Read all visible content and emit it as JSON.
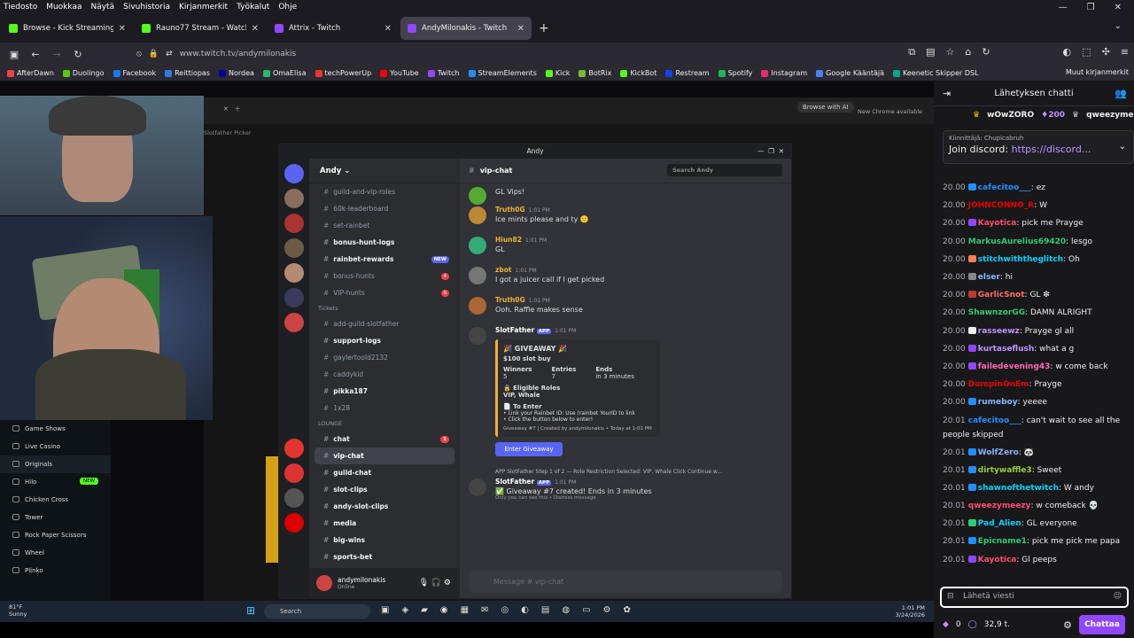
{
  "menu": [
    "Tiedosto",
    "Muokkaa",
    "Näytä",
    "Sivuhistoria",
    "Kirjanmerkit",
    "Työkalut",
    "Ohje"
  ],
  "window_controls": {
    "minimize": "—",
    "restore": "❐",
    "close": "✕"
  },
  "tabs": [
    {
      "label": "Browse - Kick Streaming",
      "color": "#53fc18"
    },
    {
      "label": "Rauno77 Stream - Watch L",
      "color": "#53fc18"
    },
    {
      "label": "Attrix - Twitch",
      "color": "#9146ff"
    },
    {
      "label": "AndyMilonakis - Twitch",
      "color": "#9146ff",
      "active": true
    }
  ],
  "tab_close": "✕",
  "url": "www.twitch.tv/andymilonakis",
  "bookmarks": [
    {
      "label": "AfterDawn",
      "color": "#e44"
    },
    {
      "label": "Duolingo",
      "color": "#58cc02"
    },
    {
      "label": "Facebook",
      "color": "#1877f2"
    },
    {
      "label": "Reittiopas",
      "color": "#2a7de1"
    },
    {
      "label": "Nordea",
      "color": "#0000a0"
    },
    {
      "label": "OmaElisa",
      "color": "#2b6"
    },
    {
      "label": "techPowerUp",
      "color": "#e33"
    },
    {
      "label": "YouTube",
      "color": "#f00"
    },
    {
      "label": "Twitch",
      "color": "#9146ff"
    },
    {
      "label": "StreamElements",
      "color": "#1e90ff"
    },
    {
      "label": "Kick",
      "color": "#53fc18"
    },
    {
      "label": "BotRix",
      "color": "#7b3"
    },
    {
      "label": "KickBot",
      "color": "#53fc18"
    },
    {
      "label": "Restream",
      "color": "#14f"
    },
    {
      "label": "Spotify",
      "color": "#1db954"
    },
    {
      "label": "Instagram",
      "color": "#e1306c"
    },
    {
      "label": "Google Kääntäjä",
      "color": "#4285f4"
    },
    {
      "label": "Keenetic Skipper DSL",
      "color": "#0a8"
    }
  ],
  "bookmarks_more": "Muut kirjanmerkit",
  "inner_browser": {
    "browse_ai": "Browse with AI",
    "chrome_available": "New Chrome available",
    "picker": "Slotfather Picker"
  },
  "kick_sidebar": [
    "Game Shows",
    "Live Casino",
    "Originals",
    "Hilo",
    "Chicken Cross",
    "Tower",
    "Rock Paper Scissors",
    "Wheel",
    "Plinko"
  ],
  "kick_new": "NEW",
  "discord": {
    "title": "Andy",
    "server": "Andy",
    "channel": "vip-chat",
    "search": "Search Andy",
    "channels": [
      {
        "name": "guild-and-vip-roles",
        "bold": false
      },
      {
        "name": "60k-leaderboard",
        "bold": false
      },
      {
        "name": "set-rainbet",
        "bold": false
      },
      {
        "name": "bonus-hunt-logs",
        "bold": true
      },
      {
        "name": "rainbet-rewards",
        "bold": true,
        "badge": "NEW"
      },
      {
        "name": "bonus-hunts",
        "bold": false,
        "badge": "4"
      },
      {
        "name": "VIP-hunts",
        "bold": false,
        "badge": "6"
      }
    ],
    "tickets_cat": "Tickets",
    "tickets": [
      {
        "name": "add-guild-slotfather",
        "bold": false
      },
      {
        "name": "support-logs",
        "bold": true
      },
      {
        "name": "gaylertoold2132",
        "bold": false
      },
      {
        "name": "caddykid",
        "bold": false
      },
      {
        "name": "pikka187",
        "bold": true
      },
      {
        "name": "1x28",
        "bold": false
      }
    ],
    "lounge_cat": "LOUNGE",
    "lounge": [
      {
        "name": "chat",
        "bold": true,
        "badge": "1"
      },
      {
        "name": "vip-chat",
        "bold": true,
        "selected": true
      },
      {
        "name": "guild-chat",
        "bold": true
      },
      {
        "name": "slot-clips",
        "bold": true
      },
      {
        "name": "andy-slot-clips",
        "bold": true
      },
      {
        "name": "media",
        "bold": true
      },
      {
        "name": "big-wins",
        "bold": true
      },
      {
        "name": "sports-bet",
        "bold": true
      }
    ],
    "user": {
      "name": "andymilonakis",
      "status": "Online"
    },
    "messages": [
      {
        "name": "",
        "time": "",
        "text": "GL Vips!",
        "color": "#dbdee1"
      },
      {
        "name": "Truth0G",
        "time": "1:01 PM",
        "text": "Ice mints please and ty 🙂",
        "color": "#f0b132"
      },
      {
        "name": "Hiun82",
        "time": "1:01 PM",
        "text": "GL",
        "color": "#f0b132"
      },
      {
        "name": "zbot",
        "time": "1:01 PM",
        "text": "I got a juicer call if I get picked",
        "color": "#f0b132"
      },
      {
        "name": "Truth0G",
        "time": "1:01 PM",
        "text": "Ooh. Raffle makes sense",
        "color": "#f0b132"
      }
    ],
    "giveaway": {
      "author": "SlotFather",
      "app": "APP",
      "time": "1:01 PM",
      "title": "GIVEAWAY",
      "subtitle": "$100 slot buy",
      "winners_label": "Winners",
      "winners": "5",
      "entries_label": "Entries",
      "entries": "7",
      "ends_label": "Ends",
      "ends": "in 3 minutes",
      "roles_label": "Eligible Roles",
      "roles": "VIP, Whale",
      "enter_label": "To Enter",
      "step1": "• Link your Rainbet ID: Use !rainbet YourID to link",
      "step2": "• Click the button below to enter!",
      "footer": "Giveaway #7 | Created by andymilonakis • Today at 1:01 PM",
      "button": "Enter Giveaway"
    },
    "reply": "APP SlotFather Step 1 of 2 — Role Restriction Selected: VIP, Whale Click Continue w...",
    "last": {
      "author": "SlotFather",
      "app": "APP",
      "time": "1:01 PM",
      "text": "✅ Giveaway #7 created! Ends in 3 minutes",
      "note": "Only you can see this • Dismiss message"
    },
    "input": "Message # vip-chat"
  },
  "taskbar": {
    "temp": "81°F",
    "weather": "Sunny",
    "search": "Search",
    "time": "1:01 PM",
    "date": "3/24/2026"
  },
  "chat": {
    "title": "Lähetyksen chatti",
    "gift1": "wOwZORO",
    "gift1_amt": "200",
    "gift2": "qweezymeezy",
    "pinned_by": "Kiinnittäjä: Chupicabruh",
    "pinned_text": "Join discord: ",
    "pinned_link": "https://discord...",
    "lines": [
      {
        "ts": "20.00",
        "user": "cafecitoo___",
        "color": "#1e90ff",
        "msg": ": ez",
        "badge": "#1e90ff"
      },
      {
        "ts": "20.00",
        "user": "JOHNCONNO_R",
        "color": "#e00",
        "msg": ": W",
        "badge": ""
      },
      {
        "ts": "20.00",
        "user": "Kayotica",
        "color": "#ff4d6d",
        "msg": ": pick me Prayge",
        "badge": "#9147ff"
      },
      {
        "ts": "20.00",
        "user": "MarkusAurelius69420",
        "color": "#2ecc71",
        "msg": ": lesgo",
        "badge": ""
      },
      {
        "ts": "20.00",
        "user": "stitchwiththeglitch",
        "color": "#00d5ff",
        "msg": ": Oh",
        "badge": "#ff7f50"
      },
      {
        "ts": "20.00",
        "user": "elser",
        "color": "#8ab4ff",
        "msg": ": hi",
        "badge": "#888"
      },
      {
        "ts": "20.00",
        "user": "GarlicSnot",
        "color": "#ff6f61",
        "msg": ": GL ❇",
        "badge": "#c0392b"
      },
      {
        "ts": "20.00",
        "user": "ShawnzorGG",
        "color": "#2ecc71",
        "msg": ": DAMN ALRIGHT",
        "badge": ""
      },
      {
        "ts": "20.00",
        "user": "rasseewz",
        "color": "#bf94ff",
        "msg": ": Prayge gl all",
        "badge": "#eee"
      },
      {
        "ts": "20.00",
        "user": "kurtaseflush",
        "color": "#bf94ff",
        "msg": ": what a g",
        "badge": "#9147ff"
      },
      {
        "ts": "20.00",
        "user": "failedevening43",
        "color": "#ff69b4",
        "msg": ": w come back",
        "badge": "#9147ff"
      },
      {
        "ts": "20.00",
        "user": "DumpinOnEm",
        "color": "#e00",
        "msg": ": Prayge",
        "badge": ""
      },
      {
        "ts": "20.00",
        "user": "rumeboy",
        "color": "#8ab4ff",
        "msg": ": yeeee",
        "badge": "#1e90ff"
      }
    ],
    "wrap1": {
      "ts": "20.01",
      "user": "cafecitoo___",
      "color": "#1e90ff",
      "msg": ": can't wait to see all the people skipped"
    },
    "lines2": [
      {
        "ts": "20.01",
        "user": "WolfZero",
        "color": "#8ab4ff",
        "msg": ": 🐼",
        "badge": "#1e90ff"
      },
      {
        "ts": "20.01",
        "user": "dirtywaffle3",
        "color": "#9acd32",
        "msg": ": Sweet",
        "badge": "#1e90ff"
      },
      {
        "ts": "20.01",
        "user": "shawnofthetwitch",
        "color": "#00d5ff",
        "msg": ": W andy",
        "badge": "#1e90ff"
      }
    ],
    "wrap2": {
      "ts": "20.01",
      "user": "qweezymeezy",
      "color": "#ff4d6d",
      "msg": ": w comeback 💀"
    },
    "lines3": [
      {
        "ts": "20.01",
        "user": "Pad_Alien",
        "color": "#00d5ff",
        "msg": ": GL everyone",
        "badge": "#2ecc71"
      },
      {
        "ts": "20.01",
        "user": "Epicname1",
        "color": "#2ecc71",
        "msg": ": pick me pick me papa",
        "badge": "#1e90ff"
      },
      {
        "ts": "20.01",
        "user": "Kayotica",
        "color": "#ff4d6d",
        "msg": ": Gl peeps",
        "badge": "#9147ff"
      }
    ],
    "input_placeholder": "Lähetä viesti",
    "points": "0",
    "viewers": "32,9 t.",
    "send": "Chattaa"
  }
}
